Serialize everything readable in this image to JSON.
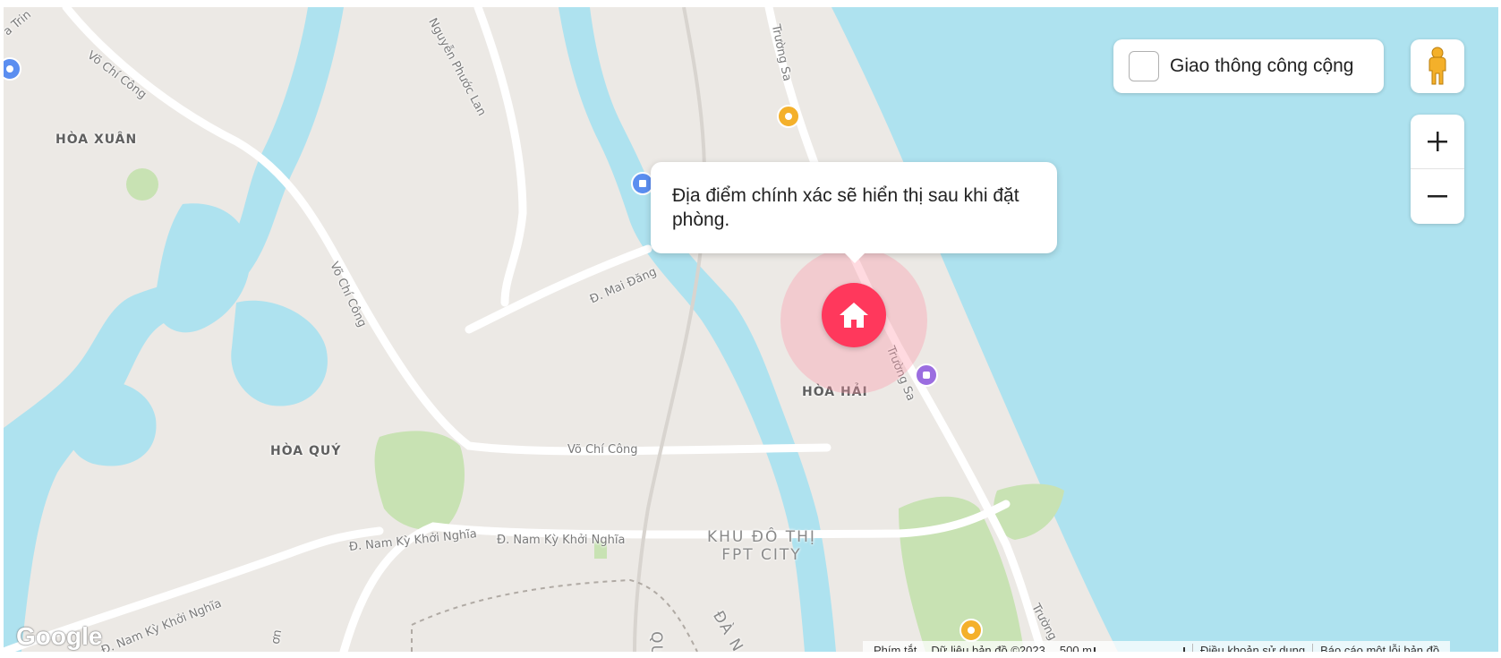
{
  "map": {
    "colors": {
      "water": "#aee2ef",
      "land": "#ece9e5",
      "park": "#c8e2b3",
      "road_major": "#ffffff",
      "accent": "#ff385c"
    },
    "area_labels": {
      "hoa_xuan": "HÒA XUÂN",
      "hoa_quy": "HÒA QUÝ",
      "hoa_hai": "HÒA HẢI",
      "khu_do_thi_line1": "KHU ĐÔ THỊ",
      "khu_do_thi_line2": "FPT CITY",
      "da_n": "ĐÀ N",
      "qu": "QU"
    },
    "street_labels": {
      "vo_chi_cong_1": "Võ Chí Công",
      "vo_chi_cong_2": "Võ Chí Công",
      "vo_chi_cong_3": "Võ Chí Công",
      "nguyen_phuoc_lan": "Nguyễn Phước Lan",
      "mai_dang": "Đ. Mai Đăng",
      "truong_sa_1": "Trường Sa",
      "truong_sa_2": "Trường Sa",
      "truong_sa_3": "Trường",
      "nam_ky_1": "Đ. Nam Kỳ Khởi Nghĩa",
      "nam_ky_2": "Đ. Nam Kỳ Khởi Nghĩa",
      "nam_ky_3": "Đ. Nam Kỳ Khởi Nghĩa",
      "a_trin": "a Trin",
      "on": "ơn"
    },
    "transit_toggle": {
      "label": "Giao thông công cộng",
      "checked": false
    },
    "popup_text": "Địa điểm chính xác sẽ hiển thị sau khi đặt phòng.",
    "icons": {
      "pegman": "street-view-pegman-icon",
      "zoom_in": "plus-icon",
      "zoom_out": "minus-icon",
      "home": "home-icon"
    },
    "footer": {
      "shortcuts": "Phím tắt",
      "map_data": "Dữ liệu bản đồ ©2023",
      "scale": "500 m",
      "terms": "Điều khoản sử dụng",
      "report": "Báo cáo một lỗi bản đồ"
    },
    "google_logo": "Google"
  }
}
